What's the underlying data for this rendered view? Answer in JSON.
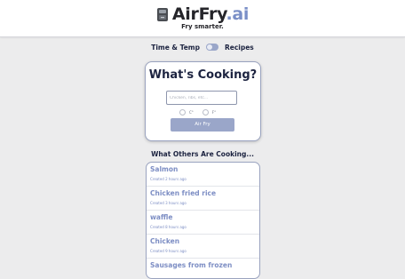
{
  "header": {
    "logo_text": "AirFry",
    "logo_suffix": ".ai",
    "tagline": "Fry smarter."
  },
  "mode_toggle": {
    "left_label": "Time & Temp",
    "right_label": "Recipes"
  },
  "cooking_card": {
    "title": "What's Cooking?",
    "input_placeholder": "Chicken, ribs, etc...",
    "input_value": "",
    "unit_options": [
      "C°",
      "F°"
    ],
    "button_label": "Air Fry"
  },
  "others": {
    "title": "What Others Are Cooking...",
    "items": [
      {
        "name": "Salmon",
        "time": "Created 2 hours ago"
      },
      {
        "name": "Chicken fried rice",
        "time": "Created 3 hours ago"
      },
      {
        "name": "waffle",
        "time": "Created 8 hours ago"
      },
      {
        "name": "Chicken",
        "time": "Created 9 hours ago"
      },
      {
        "name": "Sausages from frozen",
        "time": ""
      }
    ]
  },
  "colors": {
    "accent": "#7a8fc7",
    "button": "#9aa6c9",
    "heading": "#1c2340",
    "background": "#ececed"
  }
}
